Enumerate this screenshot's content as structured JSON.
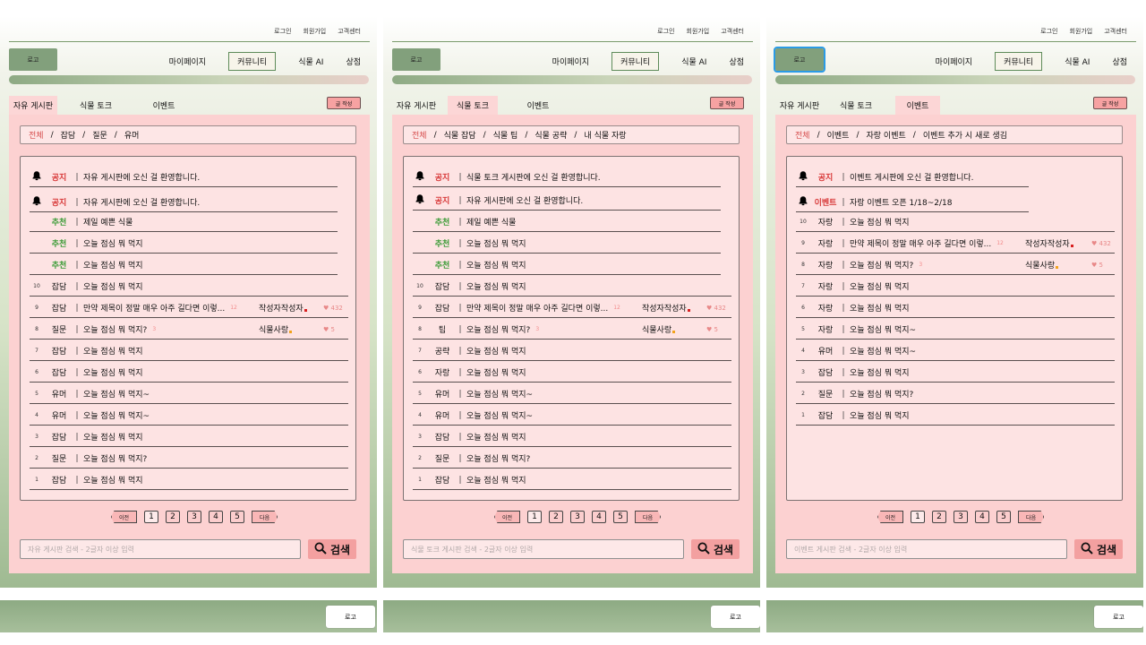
{
  "panels": [
    {
      "topbar": {
        "login": "로그인",
        "signup": "회원가입",
        "support": "고객센터"
      },
      "logo": "로고",
      "nav": {
        "mypage": "마이페이지",
        "community": "커뮤니티",
        "plant_ai": "식물 AI",
        "store": "상점"
      },
      "tabs": [
        "자유 게시판",
        "식물 토크",
        "이벤트"
      ],
      "active_tab": 0,
      "write_button": "글 작성",
      "filters": [
        "전체",
        "잡담",
        "질문",
        "유머"
      ],
      "rows": [
        {
          "type": "notice",
          "cat": "공지",
          "title": "자유 게시판에 오신 걸 환영합니다."
        },
        {
          "type": "notice",
          "cat": "공지",
          "title": "자유 게시판에 오신 걸 환영합니다."
        },
        {
          "type": "rec",
          "cat": "추천",
          "title": "제일 예쁜 식물"
        },
        {
          "type": "rec",
          "cat": "추천",
          "title": "오늘 점심 뭐 먹지"
        },
        {
          "type": "rec",
          "cat": "추천",
          "title": "오늘 점심 뭐 먹지"
        },
        {
          "num": "10",
          "cat": "잡담",
          "title": "오늘 점심 뭐 먹지"
        },
        {
          "num": "9",
          "cat": "잡담",
          "title": "만약 제목이 정말 매우 아주 길다면 이렇...",
          "count": "12",
          "author": "작성자작성자",
          "dot": "#d81f1f",
          "likes": "432"
        },
        {
          "num": "8",
          "cat": "질문",
          "title": "오늘 점심 뭐 먹지?",
          "count": "3",
          "author": "식물사랑",
          "dot": "#f2a31c",
          "likes": "5"
        },
        {
          "num": "7",
          "cat": "잡담",
          "title": "오늘 점심 뭐 먹지"
        },
        {
          "num": "6",
          "cat": "잡담",
          "title": "오늘 점심 뭐 먹지"
        },
        {
          "num": "5",
          "cat": "유머",
          "title": "오늘 점심 뭐 먹지~"
        },
        {
          "num": "4",
          "cat": "유머",
          "title": "오늘 점심 뭐 먹지~"
        },
        {
          "num": "3",
          "cat": "잡담",
          "title": "오늘 점심 뭐 먹지"
        },
        {
          "num": "2",
          "cat": "질문",
          "title": "오늘 점심 뭐 먹지?"
        },
        {
          "num": "1",
          "cat": "잡담",
          "title": "오늘 점심 뭐 먹지"
        }
      ],
      "pager": {
        "prev": "이전",
        "pages": [
          "1",
          "2",
          "3",
          "4",
          "5"
        ],
        "next": "다음"
      },
      "search_placeholder": "자유 게시판 검색 - 2글자 이상 입력",
      "search_button": "검색",
      "footer_logo": "로고"
    },
    {
      "topbar": {
        "login": "로그인",
        "signup": "회원가입",
        "support": "고객센터"
      },
      "logo": "로고",
      "nav": {
        "mypage": "마이페이지",
        "community": "커뮤니티",
        "plant_ai": "식물 AI",
        "store": "상점"
      },
      "tabs": [
        "자유 게시판",
        "식물 토크",
        "이벤트"
      ],
      "active_tab": 1,
      "write_button": "글 작성",
      "filters": [
        "전체",
        "식물 잡담",
        "식물 팁",
        "식물 공략",
        "내 식물 자랑"
      ],
      "rows": [
        {
          "type": "notice",
          "cat": "공지",
          "title": "식물 토크 게시판에 오신 걸 환영합니다."
        },
        {
          "type": "notice",
          "cat": "공지",
          "title": "자유 게시판에 오신 걸 환영합니다."
        },
        {
          "type": "rec",
          "cat": "추천",
          "title": "제일 예쁜 식물"
        },
        {
          "type": "rec",
          "cat": "추천",
          "title": "오늘 점심 뭐 먹지"
        },
        {
          "type": "rec",
          "cat": "추천",
          "title": "오늘 점심 뭐 먹지"
        },
        {
          "num": "10",
          "cat": "잡담",
          "title": "오늘 점심 뭐 먹지"
        },
        {
          "num": "9",
          "cat": "잡담",
          "title": "만약 제목이 정말 매우 아주 길다면 이렇...",
          "count": "12",
          "author": "작성자작성자",
          "dot": "#d81f1f",
          "likes": "432"
        },
        {
          "num": "8",
          "cat": "팁",
          "title": "오늘 점심 뭐 먹지?",
          "count": "3",
          "author": "식물사랑",
          "dot": "#f2a31c",
          "likes": "5"
        },
        {
          "num": "7",
          "cat": "공략",
          "title": "오늘 점심 뭐 먹지"
        },
        {
          "num": "6",
          "cat": "자랑",
          "title": "오늘 점심 뭐 먹지"
        },
        {
          "num": "5",
          "cat": "유머",
          "title": "오늘 점심 뭐 먹지~"
        },
        {
          "num": "4",
          "cat": "유머",
          "title": "오늘 점심 뭐 먹지~"
        },
        {
          "num": "3",
          "cat": "잡담",
          "title": "오늘 점심 뭐 먹지"
        },
        {
          "num": "2",
          "cat": "질문",
          "title": "오늘 점심 뭐 먹지?"
        },
        {
          "num": "1",
          "cat": "잡담",
          "title": "오늘 점심 뭐 먹지"
        }
      ],
      "pager": {
        "prev": "이전",
        "pages": [
          "1",
          "2",
          "3",
          "4",
          "5"
        ],
        "next": "다음"
      },
      "search_placeholder": "식물 토크 게시판 검색 - 2글자 이상 입력",
      "search_button": "검색",
      "footer_logo": "로고"
    },
    {
      "topbar": {
        "login": "로그인",
        "signup": "회원가입",
        "support": "고객센터"
      },
      "logo": "로고",
      "nav": {
        "mypage": "마이페이지",
        "community": "커뮤니티",
        "plant_ai": "식물 AI",
        "store": "상점"
      },
      "tabs": [
        "자유 게시판",
        "식물 토크",
        "이벤트"
      ],
      "active_tab": 2,
      "write_button": "글 작성",
      "filters": [
        "전체",
        "이벤트",
        "자랑 이벤트",
        "이벤트 추가 시 새로 생김"
      ],
      "rows": [
        {
          "type": "notice",
          "cat": "공지",
          "title": "이벤트 게시판에 오신 걸 환영합니다."
        },
        {
          "type": "notice",
          "cat": "이벤트",
          "title": "자랑 이벤트 오픈 1/18~2/18"
        },
        {
          "num": "10",
          "cat": "자랑",
          "title": "오늘 점심 뭐 먹지"
        },
        {
          "num": "9",
          "cat": "자랑",
          "title": "만약 제목이 정말 매우 아주 길다면 이렇...",
          "count": "12",
          "author": "작성자작성자",
          "dot": "#d81f1f",
          "likes": "432"
        },
        {
          "num": "8",
          "cat": "자랑",
          "title": "오늘 점심 뭐 먹지?",
          "count": "3",
          "author": "식물사랑",
          "dot": "#f2a31c",
          "likes": "5"
        },
        {
          "num": "7",
          "cat": "자랑",
          "title": "오늘 점심 뭐 먹지"
        },
        {
          "num": "6",
          "cat": "자랑",
          "title": "오늘 점심 뭐 먹지"
        },
        {
          "num": "5",
          "cat": "자랑",
          "title": "오늘 점심 뭐 먹지~"
        },
        {
          "num": "4",
          "cat": "유머",
          "title": "오늘 점심 뭐 먹지~"
        },
        {
          "num": "3",
          "cat": "잡담",
          "title": "오늘 점심 뭐 먹지"
        },
        {
          "num": "2",
          "cat": "질문",
          "title": "오늘 점심 뭐 먹지?"
        },
        {
          "num": "1",
          "cat": "잡담",
          "title": "오늘 점심 뭐 먹지"
        }
      ],
      "pager": {
        "prev": "이전",
        "pages": [
          "1",
          "2",
          "3",
          "4",
          "5"
        ],
        "next": "다음"
      },
      "search_placeholder": "이벤트 게시판 검색 - 2글자 이상 입력",
      "search_button": "검색",
      "footer_logo": "로고"
    }
  ],
  "colors": {
    "notice": "#d83a3a",
    "recommend": "#3b9b36",
    "accent_pink": "#fcd1d1",
    "brand_green": "#82a07c",
    "focus_outline": "#2a9be6"
  },
  "icons": {
    "notice": "bell-icon",
    "search": "search-icon",
    "like": "heart-icon"
  }
}
